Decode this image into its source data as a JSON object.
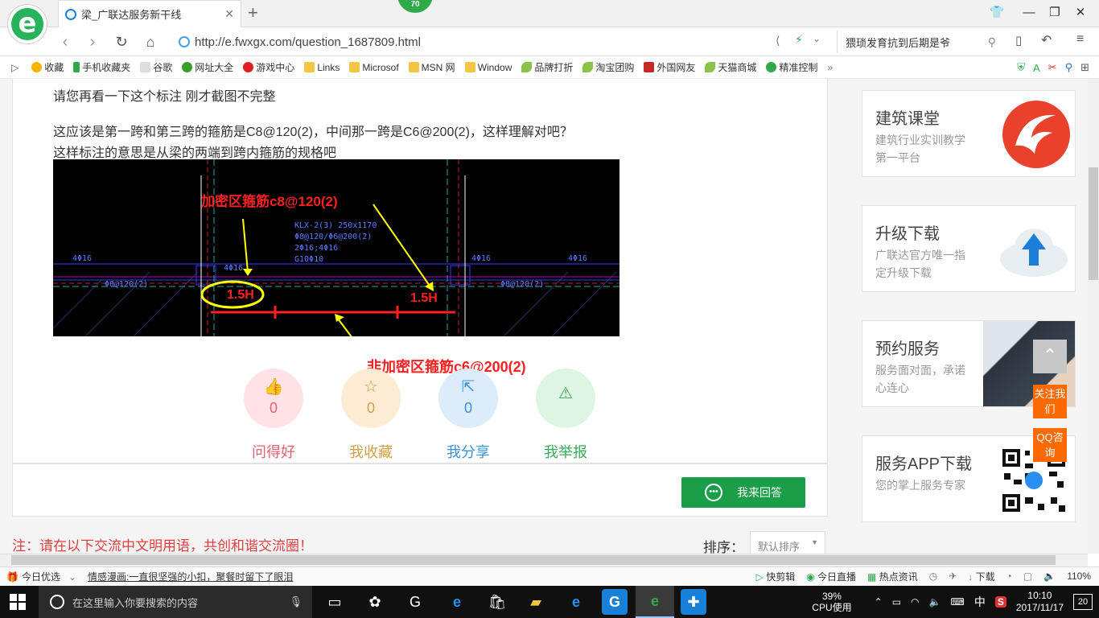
{
  "browser": {
    "badge": "70",
    "tab_title": "梁_广联达服务新干线",
    "url": "http://e.fwxgx.com/question_1687809.html",
    "search_text": "猥琐发育抗到后期是爷"
  },
  "bookmarks": [
    {
      "label": "收藏"
    },
    {
      "label": "手机收藏夹"
    },
    {
      "label": "谷歌"
    },
    {
      "label": "网址大全"
    },
    {
      "label": "游戏中心"
    },
    {
      "label": "Links"
    },
    {
      "label": "Microsof"
    },
    {
      "label": "MSN 网"
    },
    {
      "label": "Window"
    },
    {
      "label": "品牌打折"
    },
    {
      "label": "淘宝团购"
    },
    {
      "label": "外国网友"
    },
    {
      "label": "天猫商城"
    },
    {
      "label": "精准控制"
    }
  ],
  "question": {
    "line1": "请您再看一下这个标注  刚才截图不完整",
    "line2": "这应该是第一跨和第三跨的箍筋是C8@120(2)，中间那一跨是C6@200(2)，这样理解对吧？",
    "line3": "这样标注的意思是从梁的两端到跨内箍筋的规格吧"
  },
  "cad": {
    "annot_top": "加密区箍筋c8@120(2)",
    "annot_bottom": "非加密区箍筋c6@200(2)",
    "left_15h": "1.5H",
    "right_15h": "1.5H",
    "beam_text_1": "KLX-2(3) 250x1170",
    "beam_text_2": "Φ8@120/Φ6@200(2)",
    "beam_text_3": "2Φ16;4Φ16",
    "beam_text_4": "G10Φ10",
    "left_rebar": "4Φ16",
    "left_rebar2": "4Φ16",
    "right_rebar": "4Φ16",
    "right_rebar2": "4Φ16",
    "left_stirrup": "Φ8@120(2)",
    "right_stirrup": "Φ8@120(2)"
  },
  "actions": [
    {
      "label": "问得好",
      "count": "0"
    },
    {
      "label": "我收藏",
      "count": "0"
    },
    {
      "label": "我分享",
      "count": "0"
    },
    {
      "label": "我举报",
      "count": "0"
    }
  ],
  "answer_button": "我来回答",
  "notice": "注：请在以下交流中文明用语，共创和谐交流圈！",
  "sort": {
    "label": "排序：",
    "selected": "默认排序"
  },
  "sidebar": [
    {
      "title": "建筑课堂",
      "desc": "建筑行业实训教学第一平台"
    },
    {
      "title": "升级下载",
      "desc": "广联达官方唯一指定升级下载"
    },
    {
      "title": "预约服务",
      "desc": "服务面对面，承诺心连心"
    },
    {
      "title": "服务APP下载",
      "desc": "您的掌上服务专家"
    }
  ],
  "float_buttons": {
    "follow": "关注我们",
    "qq": "QQ咨询"
  },
  "statusbar": {
    "today": "今日优选",
    "news": "情感漫画:一直很坚强的小扣，聚餐时留下了眼泪",
    "kuaijianji": "快剪辑",
    "live": "今日直播",
    "hot": "热点资讯",
    "download": "下载",
    "zoom": "110%"
  },
  "taskbar": {
    "search_placeholder": "在这里输入你要搜索的内容",
    "cpu_percent": "39%",
    "cpu_label": "CPU使用",
    "ime": "中",
    "time": "10:10",
    "date": "2017/11/17",
    "notif_count": "20"
  }
}
